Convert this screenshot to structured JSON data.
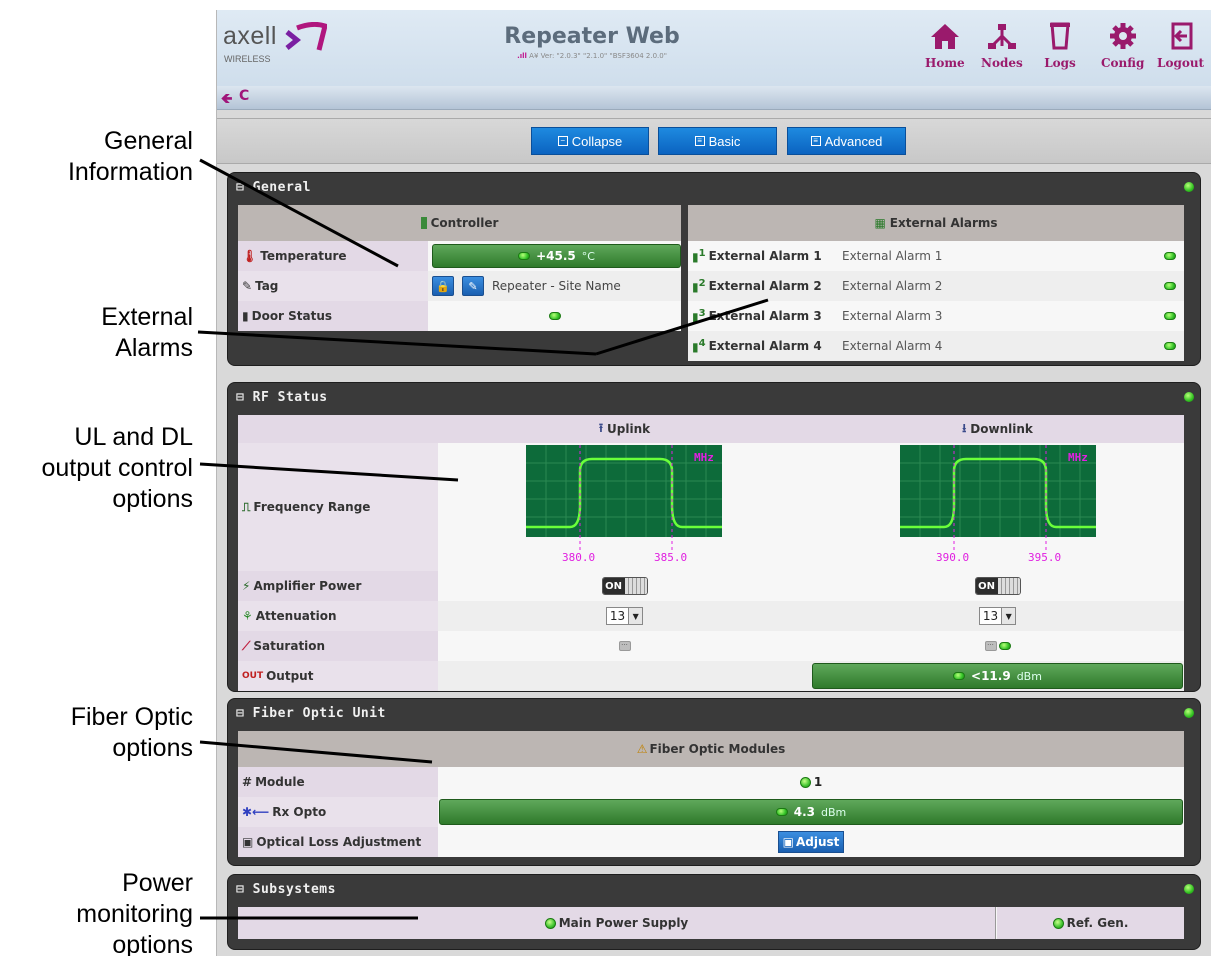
{
  "annotations": {
    "general": "General\nInformation",
    "alarms": "External\nAlarms",
    "ul_dl": "UL and DL\noutput control\noptions",
    "fiber": "Fiber Optic\noptions",
    "power": "Power\nmonitoring\noptions"
  },
  "header": {
    "logo_text": "axell",
    "logo_sub": "WIRELESS",
    "title": "Repeater Web",
    "version": "A¥ Ver: \"2.0.3\" \"2.1.0\" \"BSF3604 2.0.0\"",
    "nav": [
      {
        "label": "Home",
        "icon": "home-icon"
      },
      {
        "label": "Nodes",
        "icon": "nodes-icon"
      },
      {
        "label": "Logs",
        "icon": "logs-icon"
      },
      {
        "label": "Config",
        "icon": "gear-icon"
      },
      {
        "label": "Logout",
        "icon": "logout-icon"
      }
    ]
  },
  "toolbar": {
    "collapse": "Collapse",
    "basic": "Basic",
    "advanced": "Advanced"
  },
  "general": {
    "title": "General",
    "controller_header": "Controller",
    "rows": {
      "temperature": {
        "label": "Temperature",
        "value": "+45.5",
        "unit": "°C"
      },
      "tag": {
        "label": "Tag",
        "value": "Repeater - Site Name"
      },
      "door": {
        "label": "Door Status"
      }
    },
    "alarms_header": "External Alarms",
    "alarms": [
      {
        "label": "External Alarm 1",
        "value": "External Alarm 1",
        "num": "1"
      },
      {
        "label": "External Alarm 2",
        "value": "External Alarm 2",
        "num": "2"
      },
      {
        "label": "External Alarm 3",
        "value": "External Alarm 3",
        "num": "3"
      },
      {
        "label": "External Alarm 4",
        "value": "External Alarm 4",
        "num": "4"
      }
    ]
  },
  "rf": {
    "title": "RF Status",
    "uplink": "Uplink",
    "downlink": "Downlink",
    "freq_label": "Frequency Range",
    "mhz": "MHz",
    "ul_low": "380.0",
    "ul_high": "385.0",
    "dl_low": "390.0",
    "dl_high": "395.0",
    "amp_label": "Amplifier Power",
    "amp_on": "ON",
    "atten_label": "Attenuation",
    "ul_atten": "13",
    "dl_atten": "13",
    "sat_label": "Saturation",
    "out_label": "Output",
    "out_value": "<11.9",
    "out_unit": "dBm"
  },
  "fiber": {
    "title": "Fiber Optic Unit",
    "header": "Fiber Optic Modules",
    "module_label": "Module",
    "module_value": "1",
    "rx_label": "Rx Opto",
    "rx_value": "4.3",
    "rx_unit": "dBm",
    "loss_label": "Optical Loss Adjustment",
    "adjust": "Adjust"
  },
  "subsystems": {
    "title": "Subsystems",
    "main_power": "Main Power Supply",
    "ref_gen": "Ref. Gen."
  },
  "colors": {
    "accent": "#9a1a6c",
    "button_blue": "#0b63c0",
    "status_green": "#36c52a",
    "panel_dark": "#3a3a3a"
  }
}
